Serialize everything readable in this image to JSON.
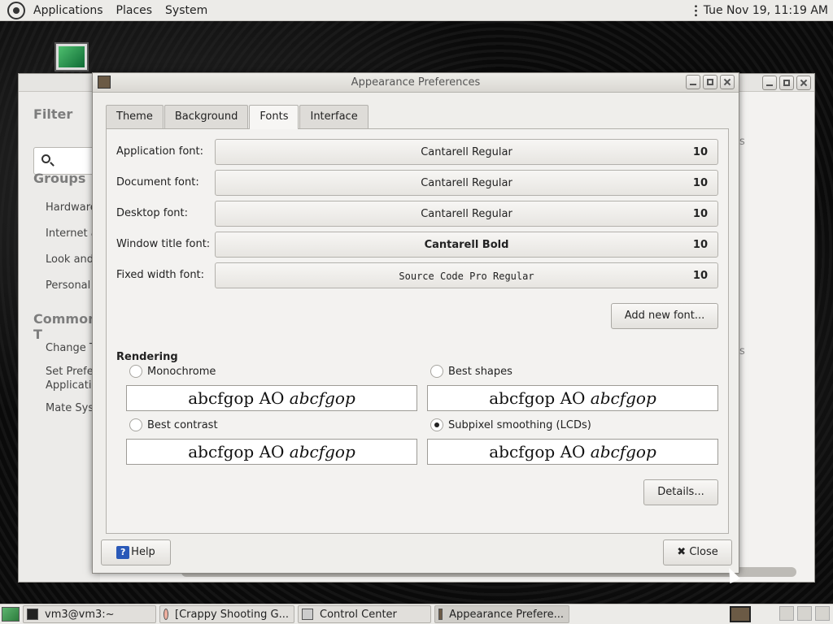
{
  "top_panel": {
    "menus": [
      "Applications",
      "Places",
      "System"
    ],
    "clock": "Tue Nov 19, 11:19 AM"
  },
  "control_center": {
    "filter_heading": "Filter",
    "groups_heading": "Groups",
    "groups": [
      "Hardware",
      "Internet a",
      "Look and",
      "Personal"
    ],
    "common_heading": "Common T",
    "common": [
      "Change T",
      "Set Prefer",
      "Applicatio",
      "Mate Syst"
    ],
    "right_fragments": [
      "s",
      "s"
    ]
  },
  "dialog": {
    "title": "Appearance Preferences",
    "tabs": [
      "Theme",
      "Background",
      "Fonts",
      "Interface"
    ],
    "active_tab": "Fonts",
    "fonts": [
      {
        "label": "Application font:",
        "name": "Cantarell Regular",
        "size": "10"
      },
      {
        "label": "Document font:",
        "name": "Cantarell Regular",
        "size": "10"
      },
      {
        "label": "Desktop font:",
        "name": "Cantarell Regular",
        "size": "10"
      },
      {
        "label": "Window title font:",
        "name": "Cantarell Bold",
        "size": "10"
      },
      {
        "label": "Fixed width font:",
        "name": "Source Code Pro Regular",
        "size": "10"
      }
    ],
    "add_font_label": "Add new font...",
    "rendering_title": "Rendering",
    "rendering_options": [
      {
        "label": "Monochrome",
        "selected": false
      },
      {
        "label": "Best shapes",
        "selected": false
      },
      {
        "label": "Best contrast",
        "selected": false
      },
      {
        "label": "Subpixel smoothing (LCDs)",
        "selected": true
      }
    ],
    "sample_text_plain": "abcfgop AO ",
    "sample_text_italic": "abcfgop",
    "details_label": "Details...",
    "help_label": "Help",
    "help_icon_glyph": "?",
    "close_label": "Close",
    "close_icon_glyph": "✖"
  },
  "taskbar": {
    "tasks": [
      {
        "label": "vm3@vm3:~",
        "active": false
      },
      {
        "label": "[Crappy Shooting G...",
        "active": false
      },
      {
        "label": "Control Center",
        "active": false
      },
      {
        "label": "Appearance Prefere...",
        "active": true
      }
    ]
  }
}
